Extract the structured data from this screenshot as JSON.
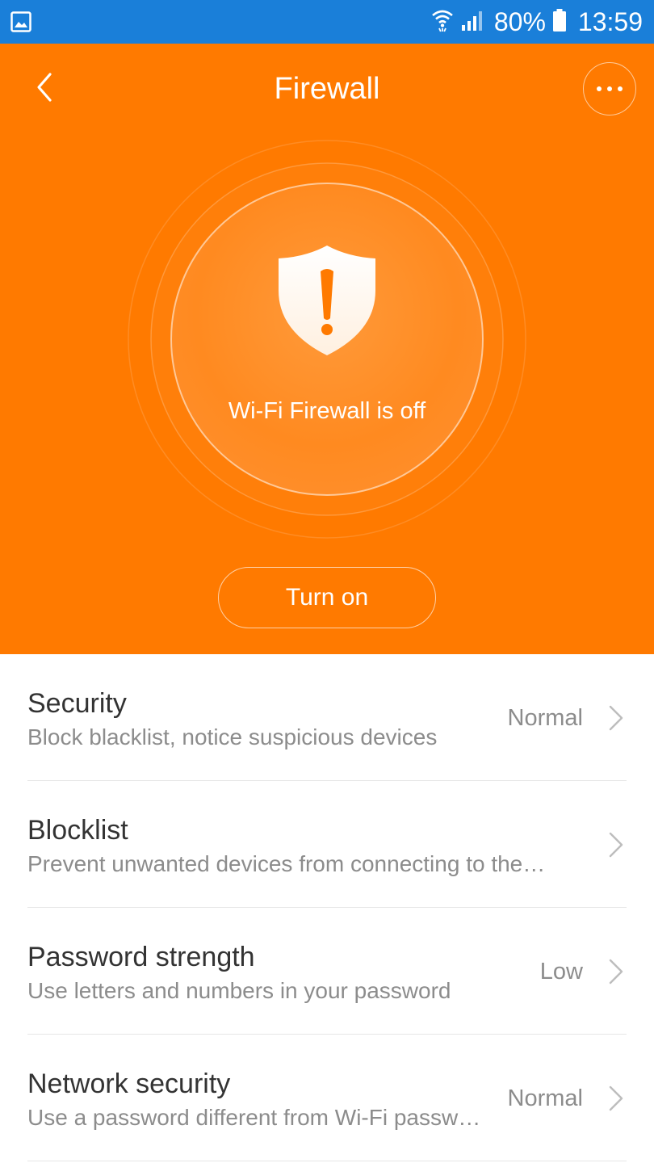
{
  "status_bar": {
    "battery_percent": "80%",
    "time": "13:59",
    "icons": [
      "gallery-icon",
      "wifi-icon",
      "cellular-signal-icon",
      "battery-icon"
    ]
  },
  "header": {
    "title": "Firewall",
    "back_icon": "chevron-left-icon",
    "more_icon": "more-dots-icon"
  },
  "hero": {
    "status_icon": "shield-alert-icon",
    "status_message": "Wi-Fi Firewall is off",
    "turn_on_label": "Turn on"
  },
  "settings": {
    "items": [
      {
        "title": "Security",
        "description": "Block blacklist, notice suspicious devices",
        "value": "Normal"
      },
      {
        "title": "Blocklist",
        "description": "Prevent unwanted devices from connecting to the…",
        "value": ""
      },
      {
        "title": "Password strength",
        "description": "Use letters and numbers in your password",
        "value": "Low"
      },
      {
        "title": "Network security",
        "description": "Use a password different from Wi-Fi passw…",
        "value": "Normal"
      }
    ]
  },
  "colors": {
    "status_bar": "#1a7fd9",
    "accent_orange": "#ff7a00",
    "text_primary": "#333333",
    "text_secondary": "#8c8c8c",
    "divider": "#e6e6e6"
  }
}
